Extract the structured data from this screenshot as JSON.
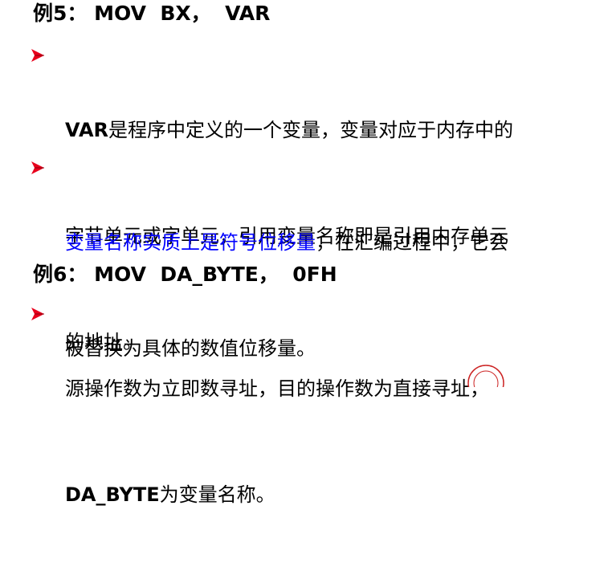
{
  "example5": {
    "prefix": "例5：",
    "code": "MOV  BX，  VAR"
  },
  "bullet1": {
    "lead_bold": "VAR",
    "line1_rest": "是程序中定义的一个变量，变量对应于内存中的",
    "line2": "字节单元或字单元，引用变量名称即是引用内存单元",
    "line3": "的地址。"
  },
  "bullet2": {
    "highlight": "变量名称实质上是符号位移量",
    "line1_rest": "，在汇编过程中，它会",
    "line2": "被替换为具体的数值位移量。"
  },
  "example6": {
    "prefix": "例6：",
    "code": "MOV  DA_BYTE，  0FH"
  },
  "bullet3": {
    "line1": "源操作数为立即数寻址，目的操作数为直接寻址，",
    "lead_bold": "DA_BYTE",
    "line2_rest": "为变量名称。"
  },
  "colors": {
    "arrow_red": "#e8001c",
    "highlight_blue": "#0000ff",
    "text": "#000000"
  },
  "icons": [
    "arrow-bullet-icon",
    "seal-logo-icon"
  ]
}
